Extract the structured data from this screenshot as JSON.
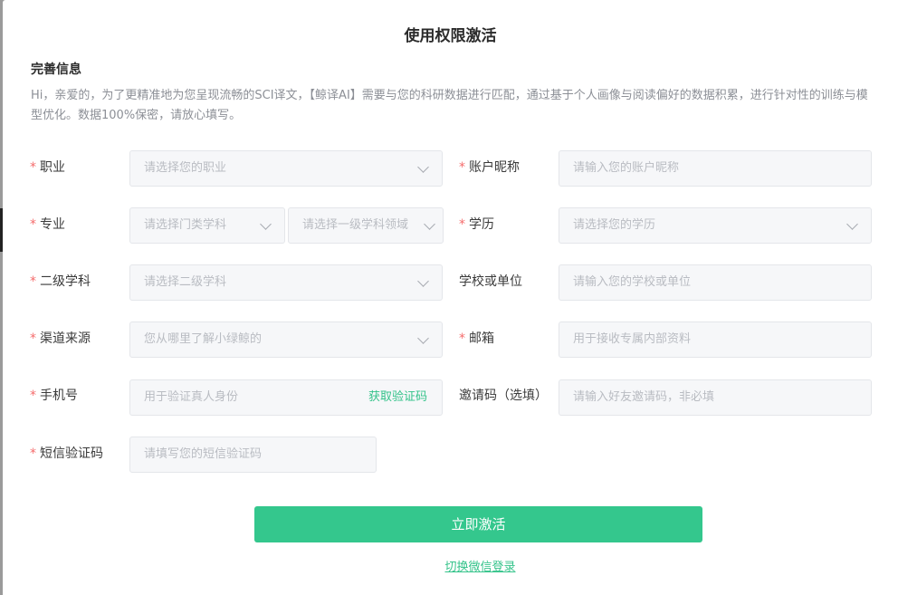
{
  "modal": {
    "title": "使用权限激活",
    "section_title": "完善信息",
    "intro": "Hi，亲爱的，为了更精准地为您呈现流畅的SCI译文，【鲸译AI】需要与您的科研数据进行匹配，通过基于个人画像与阅读偏好的数据积累，进行针对性的训练与模型优化。数据100%保密，请放心填写。"
  },
  "fields": {
    "occupation": {
      "label": "职业",
      "required": "*",
      "placeholder": "请选择您的职业"
    },
    "nickname": {
      "label": "账户昵称",
      "required": "*",
      "placeholder": "请输入您的账户昵称"
    },
    "major": {
      "label": "专业",
      "required": "*",
      "placeholder_category": "请选择门类学科",
      "placeholder_primary": "请选择一级学科领域"
    },
    "education": {
      "label": "学历",
      "required": "*",
      "placeholder": "请选择您的学历"
    },
    "secondary_subject": {
      "label": "二级学科",
      "required": "*",
      "placeholder": "请选择二级学科"
    },
    "school": {
      "label": "学校或单位",
      "placeholder": "请输入您的学校或单位"
    },
    "channel": {
      "label": "渠道来源",
      "required": "*",
      "placeholder": "您从哪里了解小绿鲸的"
    },
    "email": {
      "label": "邮箱",
      "required": "*",
      "placeholder": "用于接收专属内部资料"
    },
    "phone": {
      "label": "手机号",
      "required": "*",
      "placeholder": "用于验证真人身份",
      "code_link": "获取验证码"
    },
    "invite_code": {
      "label": "邀请码（选填）",
      "placeholder": "请输入好友邀请码，非必填"
    },
    "sms_code": {
      "label": "短信验证码",
      "required": "*",
      "placeholder": "请填写您的短信验证码"
    }
  },
  "actions": {
    "submit_label": "立即激活",
    "switch_label": "切换微信登录"
  },
  "colors": {
    "accent": "#34c78d",
    "required": "#f56c6c",
    "input_bg": "#f6f7f9"
  },
  "icons": {
    "dropdown": "chevron-down-icon"
  }
}
